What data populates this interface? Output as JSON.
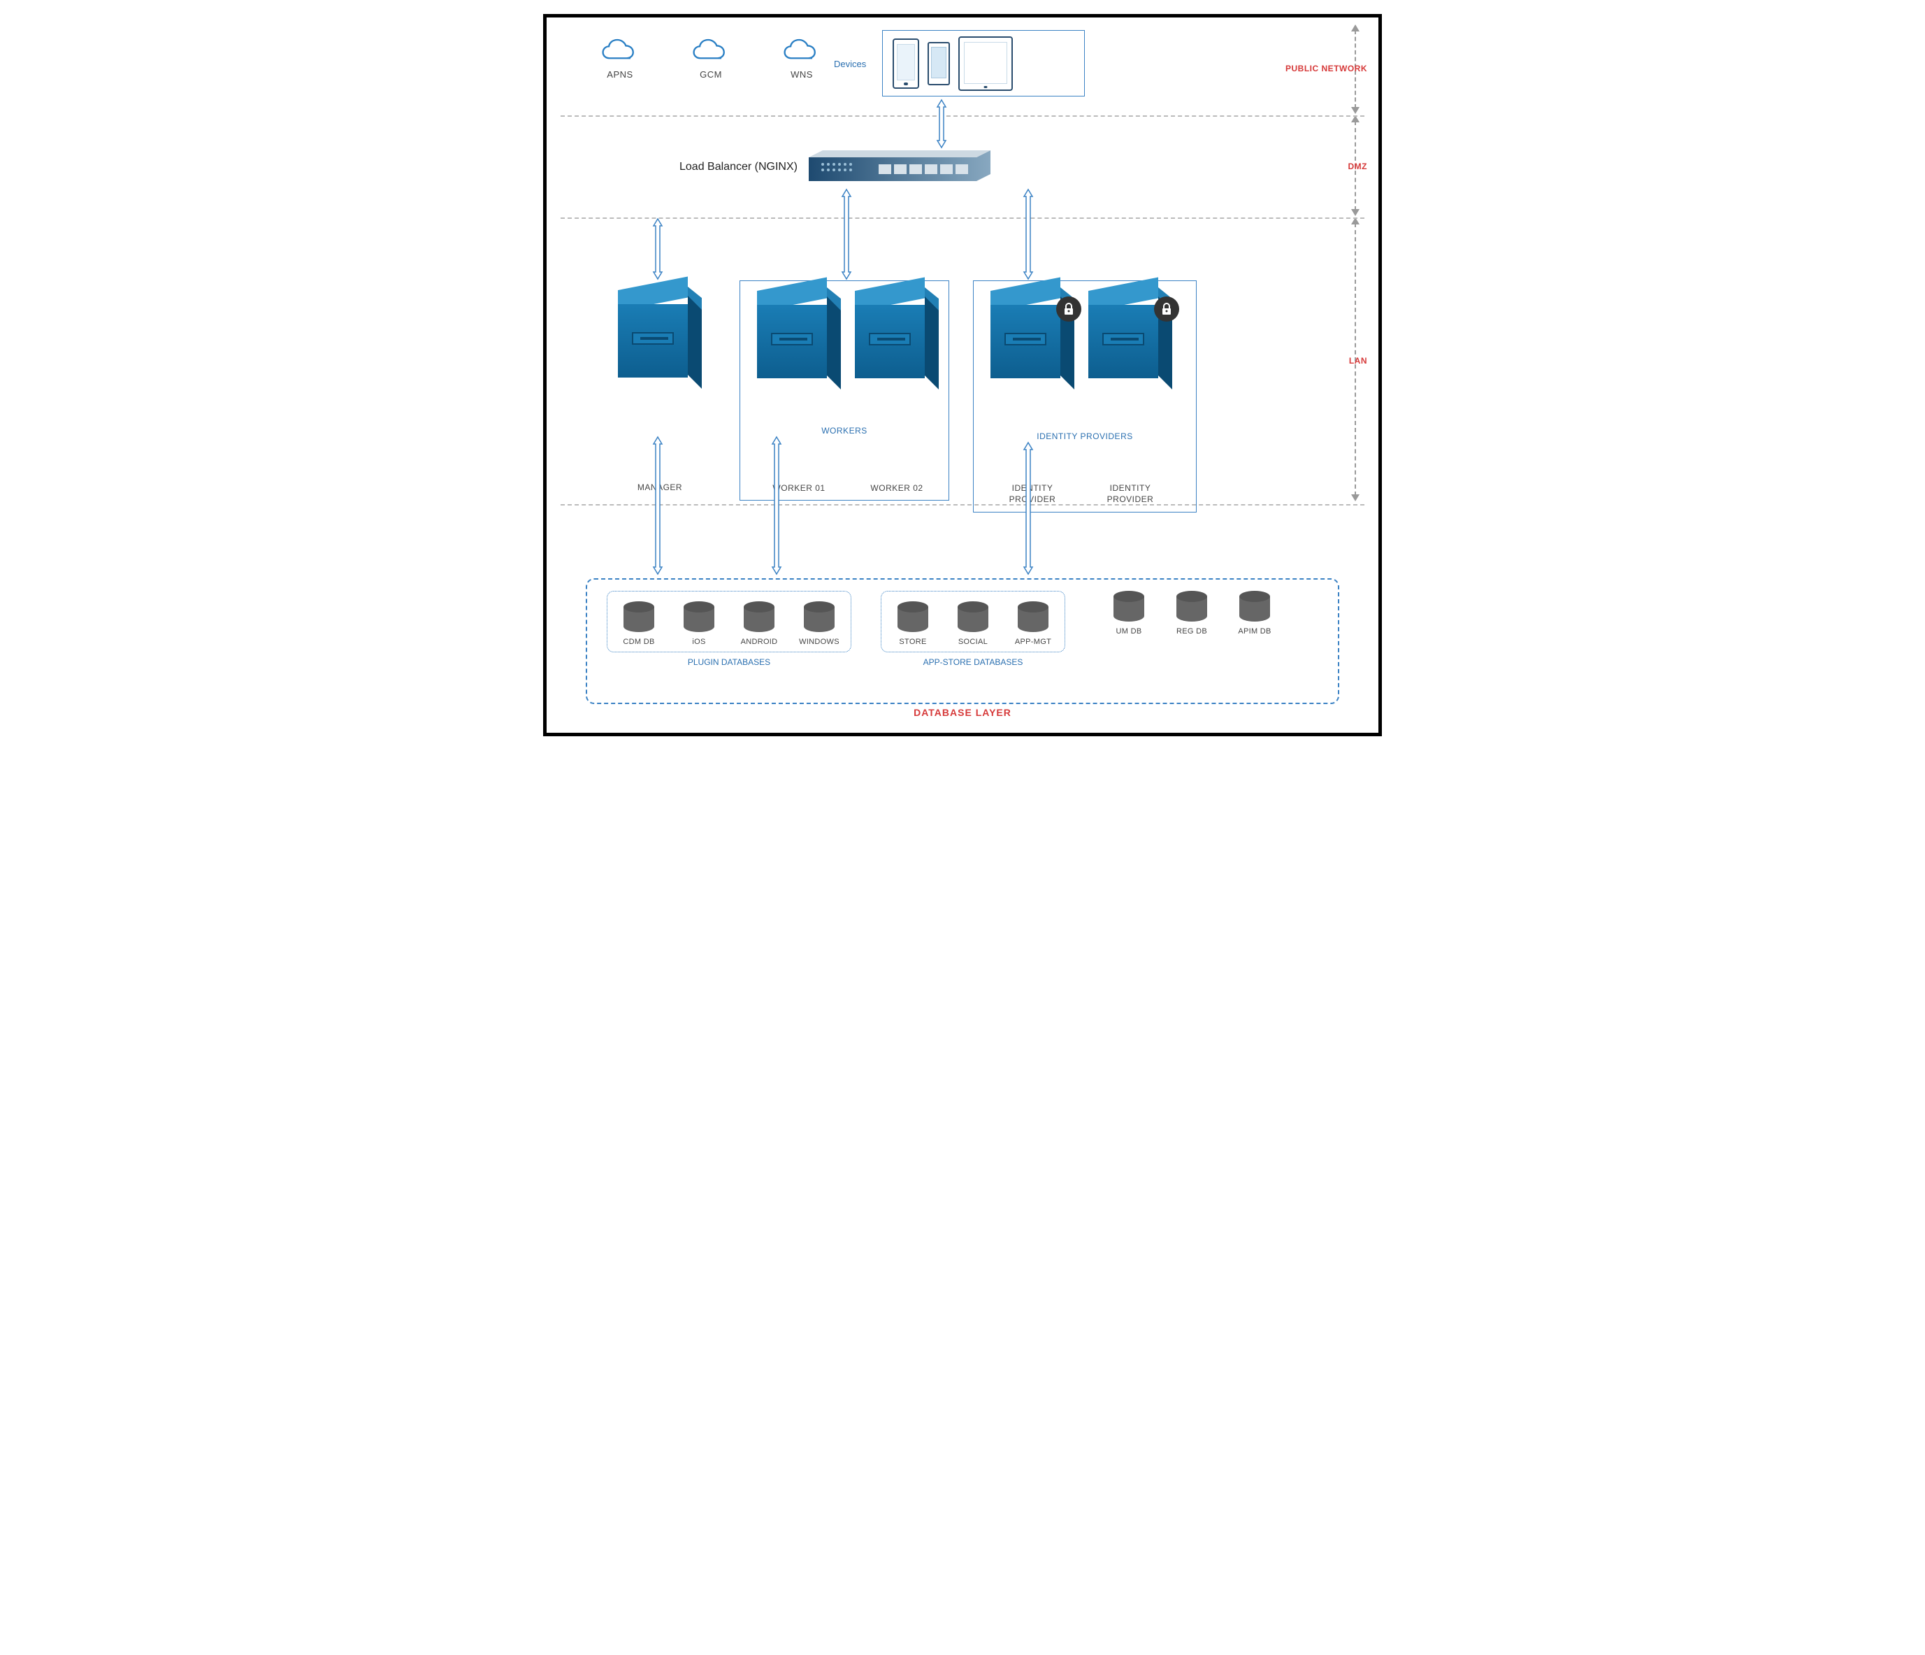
{
  "zones": {
    "public": "PUBLIC NETWORK",
    "dmz": "DMZ",
    "lan": "LAN"
  },
  "clouds": [
    {
      "label": "APNS"
    },
    {
      "label": "GCM"
    },
    {
      "label": "WNS"
    }
  ],
  "devices": {
    "label": "Devices"
  },
  "load_balancer": {
    "label": "Load Balancer (NGINX)"
  },
  "manager": {
    "label": "MANAGER"
  },
  "workers": {
    "group_label": "WORKERS",
    "items": [
      "WORKER 01",
      "WORKER 02"
    ]
  },
  "identity_providers": {
    "group_label": "IDENTITY PROVIDERS",
    "items": [
      "IDENTITY PROVIDER",
      "IDENTITY PROVIDER"
    ]
  },
  "database_layer": {
    "title": "DATABASE LAYER",
    "plugin": {
      "group_label": "PLUGIN DATABASES",
      "items": [
        "CDM DB",
        "iOS",
        "ANDROID",
        "WINDOWS"
      ]
    },
    "appstore": {
      "group_label": "APP-STORE DATABASES",
      "items": [
        "STORE",
        "SOCIAL",
        "APP-MGT"
      ]
    },
    "loose": [
      "UM DB",
      "REG DB",
      "APIM DB"
    ]
  }
}
